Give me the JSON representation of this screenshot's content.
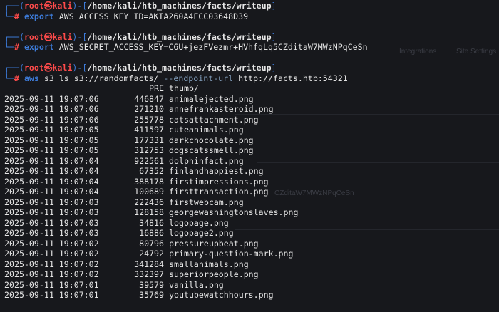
{
  "prompt": {
    "user": "root",
    "sep": "㉿",
    "host": "kali",
    "cwd": "/home/kali/htb_machines/facts/writeup"
  },
  "commands": [
    {
      "cmd": "export",
      "arg": "AWS_ACCESS_KEY_ID=AKIA260A4FCC03648D39"
    },
    {
      "cmd": "export",
      "arg": "AWS_SECRET_ACCESS_KEY=C6U+jezFVezmr+HVhfqLq5CZditaW7MWzNPqCeSn"
    },
    {
      "cmd": "aws",
      "arg": "s3 ls s3://randomfacts/ ",
      "opt": "--endpoint-url",
      "tail": " http://facts.htb:54321"
    }
  ],
  "listing": {
    "header": {
      "pre": "PRE",
      "prefix": "thumb/"
    },
    "rows": [
      {
        "date": "2025-09-11 19:07:06",
        "size": "446847",
        "name": "animalejected.png"
      },
      {
        "date": "2025-09-11 19:07:06",
        "size": "271210",
        "name": "annefrankasteroid.png"
      },
      {
        "date": "2025-09-11 19:07:06",
        "size": "255778",
        "name": "catsattachment.png"
      },
      {
        "date": "2025-09-11 19:07:05",
        "size": "411597",
        "name": "cuteanimals.png"
      },
      {
        "date": "2025-09-11 19:07:05",
        "size": "177331",
        "name": "darkchocolate.png"
      },
      {
        "date": "2025-09-11 19:07:05",
        "size": "312753",
        "name": "dogscatssmell.png"
      },
      {
        "date": "2025-09-11 19:07:04",
        "size": "922561",
        "name": "dolphinfact.png"
      },
      {
        "date": "2025-09-11 19:07:04",
        "size": "67352",
        "name": "finlandhappiest.png"
      },
      {
        "date": "2025-09-11 19:07:04",
        "size": "388178",
        "name": "firstimpressions.png"
      },
      {
        "date": "2025-09-11 19:07:04",
        "size": "100689",
        "name": "firsttransaction.png"
      },
      {
        "date": "2025-09-11 19:07:03",
        "size": "222436",
        "name": "firstwebcam.png"
      },
      {
        "date": "2025-09-11 19:07:03",
        "size": "128158",
        "name": "georgewashingtonslaves.png"
      },
      {
        "date": "2025-09-11 19:07:03",
        "size": "34816",
        "name": "logopage.png"
      },
      {
        "date": "2025-09-11 19:07:03",
        "size": "16886",
        "name": "logopage2.png"
      },
      {
        "date": "2025-09-11 19:07:02",
        "size": "80796",
        "name": "pressureupbeat.png"
      },
      {
        "date": "2025-09-11 19:07:02",
        "size": "24792",
        "name": "primary-question-mark.png"
      },
      {
        "date": "2025-09-11 19:07:02",
        "size": "341284",
        "name": "smallanimals.png"
      },
      {
        "date": "2025-09-11 19:07:02",
        "size": "332397",
        "name": "superiorpeople.png"
      },
      {
        "date": "2025-09-11 19:07:01",
        "size": "39579",
        "name": "vanilla.png"
      },
      {
        "date": "2025-09-11 19:07:01",
        "size": "35769",
        "name": "youtubewatchhours.png"
      }
    ]
  },
  "ghost_texts": [
    "Integrations",
    "Site Settings",
    "CZditaW7MWzNPqCeSn"
  ]
}
